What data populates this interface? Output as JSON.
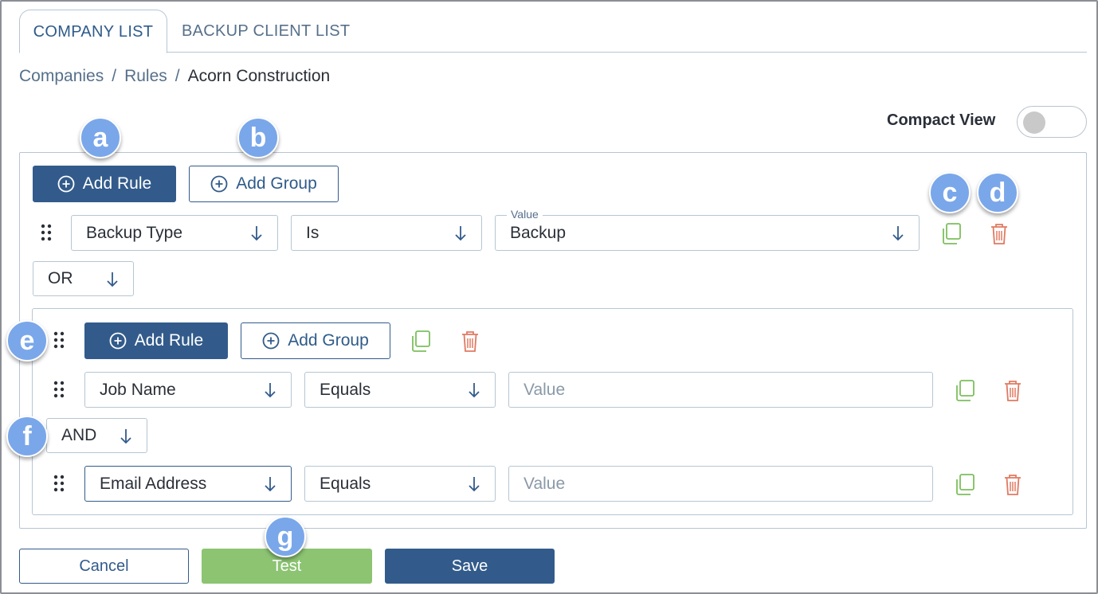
{
  "tabs": [
    {
      "label": "COMPANY LIST",
      "active": true
    },
    {
      "label": "BACKUP CLIENT LIST",
      "active": false
    }
  ],
  "breadcrumb": {
    "items": [
      "Companies",
      "Rules",
      "Acorn Construction"
    ],
    "separator": "/"
  },
  "compact_view": {
    "label": "Compact View",
    "enabled": false
  },
  "outer_group": {
    "add_rule_label": "Add Rule",
    "add_group_label": "Add Group",
    "rule": {
      "field": "Backup Type",
      "operator": "Is",
      "value_label": "Value",
      "value": "Backup"
    },
    "connector": "OR"
  },
  "inner_group": {
    "add_rule_label": "Add Rule",
    "add_group_label": "Add Group",
    "rules": [
      {
        "field": "Job Name",
        "operator": "Equals",
        "value_placeholder": "Value"
      },
      {
        "field": "Email Address",
        "operator": "Equals",
        "value_placeholder": "Value"
      }
    ],
    "connector": "AND"
  },
  "footer": {
    "cancel_label": "Cancel",
    "test_label": "Test",
    "save_label": "Save"
  },
  "callouts": {
    "a": "a",
    "b": "b",
    "c": "c",
    "d": "d",
    "e": "e",
    "f": "f",
    "g": "g"
  },
  "colors": {
    "primary": "#325b8b",
    "test_green": "#8cc472",
    "copy_green": "#7dbf5e",
    "delete_red": "#e07a62",
    "callout_blue": "#7aa7ea"
  },
  "icons": {
    "add": "plus-circle-icon",
    "drag": "drag-handle-icon",
    "copy": "copy-icon",
    "delete": "trash-icon",
    "dropdown": "arrow-down-icon"
  }
}
